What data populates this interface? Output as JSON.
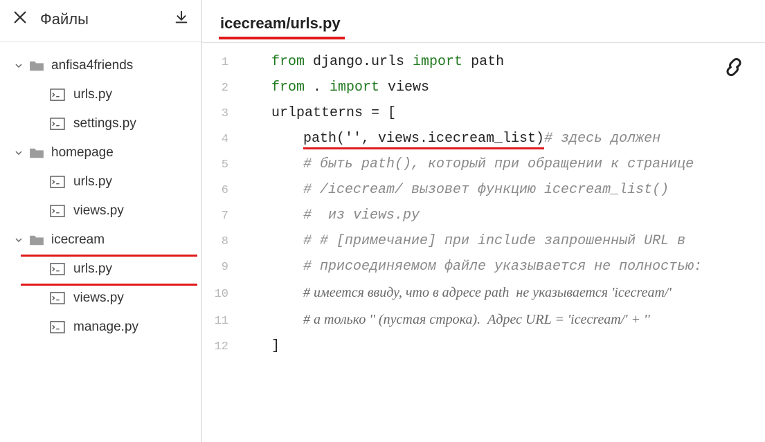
{
  "sidebar": {
    "title": "Файлы",
    "folders": [
      {
        "name": "anfisa4friends",
        "files": [
          {
            "name": "urls.py"
          },
          {
            "name": "settings.py"
          }
        ]
      },
      {
        "name": "homepage",
        "files": [
          {
            "name": "urls.py"
          },
          {
            "name": "views.py"
          }
        ]
      },
      {
        "name": "icecream",
        "files": [
          {
            "name": "urls.py"
          },
          {
            "name": "views.py"
          }
        ]
      }
    ],
    "root_files": [
      {
        "name": "manage.py"
      }
    ]
  },
  "editor": {
    "tab_title": "icecream/urls.py",
    "lines": {
      "l1_kw1": "from",
      "l1_txt1": " django.urls ",
      "l1_kw2": "import",
      "l1_txt2": " path",
      "l2_kw1": "from",
      "l2_txt1": " . ",
      "l2_kw2": "import",
      "l2_txt2": " views",
      "l3": "urlpatterns = [",
      "l4_call": "path('', views.icecream_list)",
      "l4_cm": "# здесь должен",
      "l5_cm": "# быть path(), который при обращении к странице",
      "l6_cm": "# /icecream/ вызовет функцию icecream_list()",
      "l7_cm": "#  из views.py",
      "l8_cm": "# # [примечание] при include запрошенный URL в",
      "l9_cm": "# присоединяемом файле указывается не полностью:",
      "l10_cm": "# имеется ввиду, что в адресе path  не указывается 'icecream/'",
      "l11_cm": "# а только '' (пустая строка).  Адрес URL = 'icecream/' + ''",
      "l12": "]"
    }
  }
}
